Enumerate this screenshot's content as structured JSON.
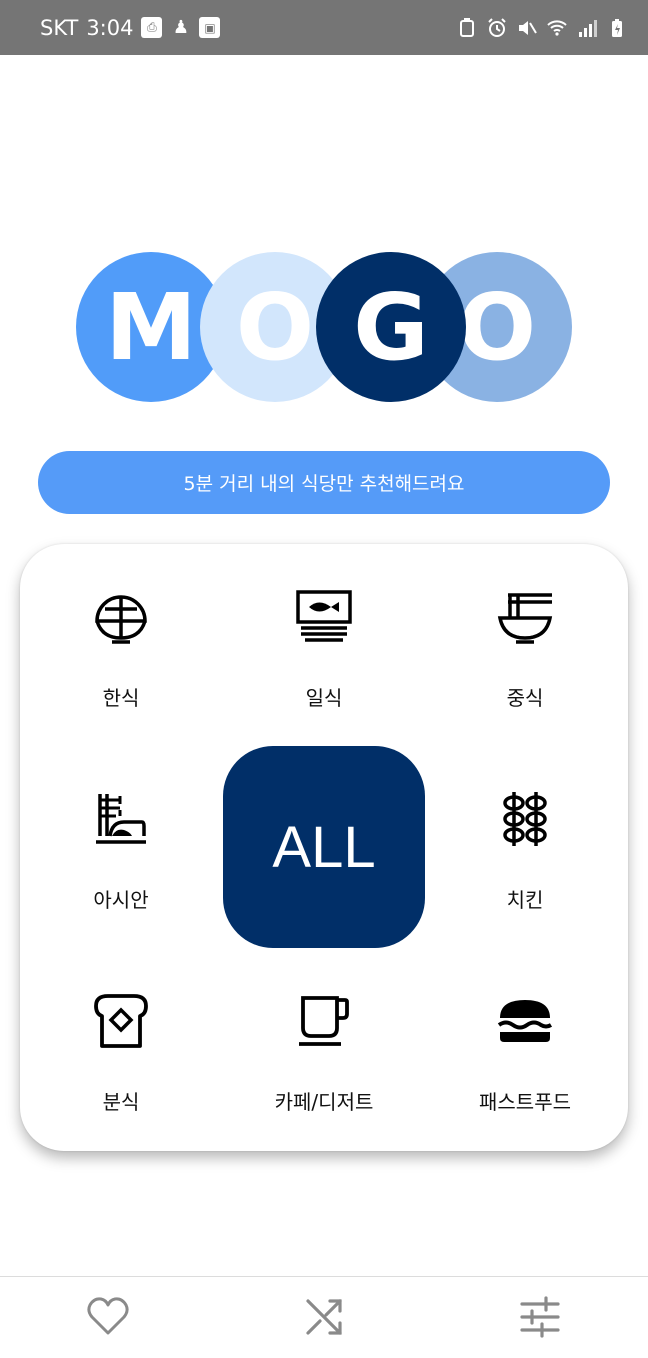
{
  "status_bar": {
    "carrier": "SKT",
    "time": "3:04"
  },
  "logo": {
    "letters": [
      "M",
      "O",
      "G",
      "O"
    ],
    "colors": [
      "#519cf9",
      "#d2e6fc",
      "#012f68",
      "#8ab2e3"
    ]
  },
  "banner": {
    "text": "5분 거리 내의 식당만 추천해드려요",
    "color": "#559bf8"
  },
  "categories": [
    {
      "label": "한식",
      "icon": "rice-bowl-icon"
    },
    {
      "label": "일식",
      "icon": "sushi-plate-icon"
    },
    {
      "label": "중식",
      "icon": "noodle-bowl-icon"
    },
    {
      "label": "아시안",
      "icon": "ramen-chopsticks-icon"
    },
    {
      "label": "치킨",
      "icon": "skewer-icon"
    },
    {
      "label": "분식",
      "icon": "toast-icon"
    },
    {
      "label": "카페/디저트",
      "icon": "coffee-cup-icon"
    },
    {
      "label": "패스트푸드",
      "icon": "burger-icon"
    }
  ],
  "all_button": {
    "label": "ALL",
    "color": "#012f68"
  },
  "bottom_nav": [
    {
      "name": "favorites",
      "icon": "heart-icon"
    },
    {
      "name": "random",
      "icon": "shuffle-icon"
    },
    {
      "name": "filters",
      "icon": "sliders-icon"
    }
  ]
}
